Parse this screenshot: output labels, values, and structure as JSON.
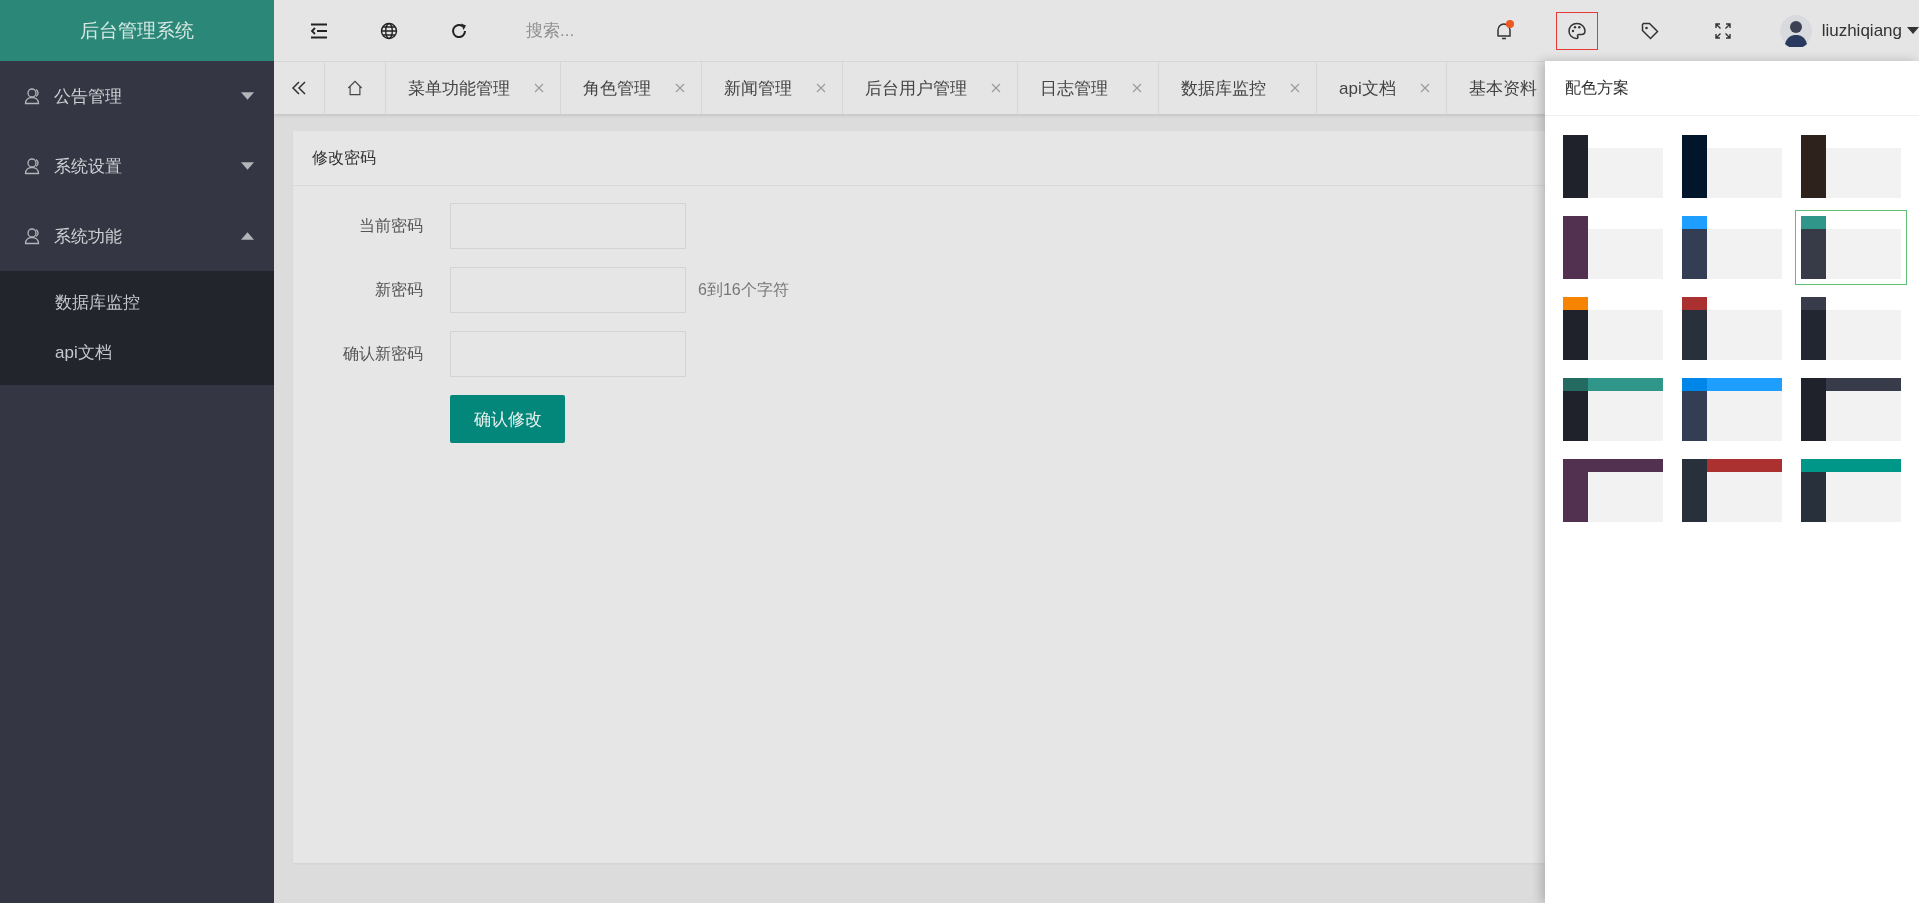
{
  "logo": {
    "title": "后台管理系统"
  },
  "header": {
    "search": {
      "placeholder": "搜索..."
    },
    "tools": [
      {
        "kind": "bell",
        "badge": true,
        "selected": false
      },
      {
        "kind": "palette",
        "selected": true
      },
      {
        "kind": "tag",
        "selected": false
      },
      {
        "kind": "fullscreen",
        "selected": false
      }
    ],
    "user": {
      "name": "liuzhiqiang"
    }
  },
  "sidebar": {
    "items": [
      {
        "label": "公告管理",
        "expanded": false
      },
      {
        "label": "系统设置",
        "expanded": false
      },
      {
        "label": "系统功能",
        "expanded": true,
        "children": [
          {
            "label": "数据库监控"
          },
          {
            "label": "api文档"
          }
        ]
      }
    ]
  },
  "tabs": [
    {
      "label": "菜单功能管理"
    },
    {
      "label": "角色管理"
    },
    {
      "label": "新闻管理"
    },
    {
      "label": "后台用户管理"
    },
    {
      "label": "日志管理"
    },
    {
      "label": "数据库监控"
    },
    {
      "label": "api文档"
    },
    {
      "label": "基本资料"
    }
  ],
  "card": {
    "title": "修改密码",
    "fields": [
      {
        "label": "当前密码"
      },
      {
        "label": "新密码",
        "hint": "6到16个字符"
      },
      {
        "label": "确认新密码"
      }
    ],
    "submit": "确认修改"
  },
  "theme_panel": {
    "title": "配色方案",
    "schemes": [
      {
        "selected": false,
        "parts": [
          {
            "kind": "logo",
            "color": "#1f222a"
          },
          {
            "kind": "sidebar",
            "color": "#1f222a"
          },
          {
            "kind": "header",
            "color": "#ffffff"
          }
        ]
      },
      {
        "selected": false,
        "parts": [
          {
            "kind": "logo",
            "color": "#02162b"
          },
          {
            "kind": "sidebar",
            "color": "#02162b"
          },
          {
            "kind": "header",
            "color": "#ffffff"
          }
        ]
      },
      {
        "selected": false,
        "parts": [
          {
            "kind": "logo",
            "color": "#2e231c"
          },
          {
            "kind": "sidebar",
            "color": "#2e231c"
          },
          {
            "kind": "header",
            "color": "#ffffff"
          }
        ]
      },
      {
        "selected": false,
        "parts": [
          {
            "kind": "logo",
            "color": "#51314f"
          },
          {
            "kind": "sidebar",
            "color": "#51314f"
          },
          {
            "kind": "header",
            "color": "#ffffff"
          }
        ]
      },
      {
        "selected": false,
        "parts": [
          {
            "kind": "logo",
            "color": "#1e9fff"
          },
          {
            "kind": "sidebar",
            "color": "#333e55"
          },
          {
            "kind": "header",
            "color": "#ffffff"
          }
        ]
      },
      {
        "selected": true,
        "parts": [
          {
            "kind": "logo",
            "color": "#31968a"
          },
          {
            "kind": "sidebar",
            "color": "#373b48"
          },
          {
            "kind": "header",
            "color": "#ffffff"
          }
        ]
      },
      {
        "selected": false,
        "parts": [
          {
            "kind": "logo",
            "color": "#f78400"
          },
          {
            "kind": "sidebar",
            "color": "#1f222a"
          },
          {
            "kind": "header",
            "color": "#ffffff"
          }
        ]
      },
      {
        "selected": false,
        "parts": [
          {
            "kind": "logo",
            "color": "#aa3130"
          },
          {
            "kind": "sidebar",
            "color": "#28313b"
          },
          {
            "kind": "header",
            "color": "#ffffff"
          }
        ]
      },
      {
        "selected": false,
        "parts": [
          {
            "kind": "logo",
            "color": "#383c4a"
          },
          {
            "kind": "sidebar",
            "color": "#222630"
          },
          {
            "kind": "header",
            "color": "#ffffff"
          }
        ]
      },
      {
        "selected": false,
        "parts": [
          {
            "kind": "logo",
            "color": "#236a61"
          },
          {
            "kind": "sidebar",
            "color": "#1f222a"
          },
          {
            "kind": "header",
            "color": "#31968a"
          }
        ]
      },
      {
        "selected": false,
        "parts": [
          {
            "kind": "logo",
            "color": "#0086e8"
          },
          {
            "kind": "sidebar",
            "color": "#333e55"
          },
          {
            "kind": "header",
            "color": "#1e9fff"
          }
        ]
      },
      {
        "selected": false,
        "parts": [
          {
            "kind": "logo",
            "color": "#1f222a"
          },
          {
            "kind": "sidebar",
            "color": "#1f222a"
          },
          {
            "kind": "header",
            "color": "#383c4a"
          }
        ]
      },
      {
        "selected": false,
        "parts": [
          {
            "kind": "logo",
            "color": "#51314f"
          },
          {
            "kind": "sidebar",
            "color": "#51314f"
          },
          {
            "kind": "header",
            "color": "#51314f"
          }
        ]
      },
      {
        "selected": false,
        "parts": [
          {
            "kind": "logo",
            "color": "#28313b"
          },
          {
            "kind": "sidebar",
            "color": "#28313b"
          },
          {
            "kind": "header",
            "color": "#aa3130"
          }
        ]
      },
      {
        "selected": false,
        "parts": [
          {
            "kind": "logo",
            "color": "#009688"
          },
          {
            "kind": "sidebar",
            "color": "#28313b"
          },
          {
            "kind": "header",
            "color": "#009688"
          }
        ]
      }
    ]
  }
}
